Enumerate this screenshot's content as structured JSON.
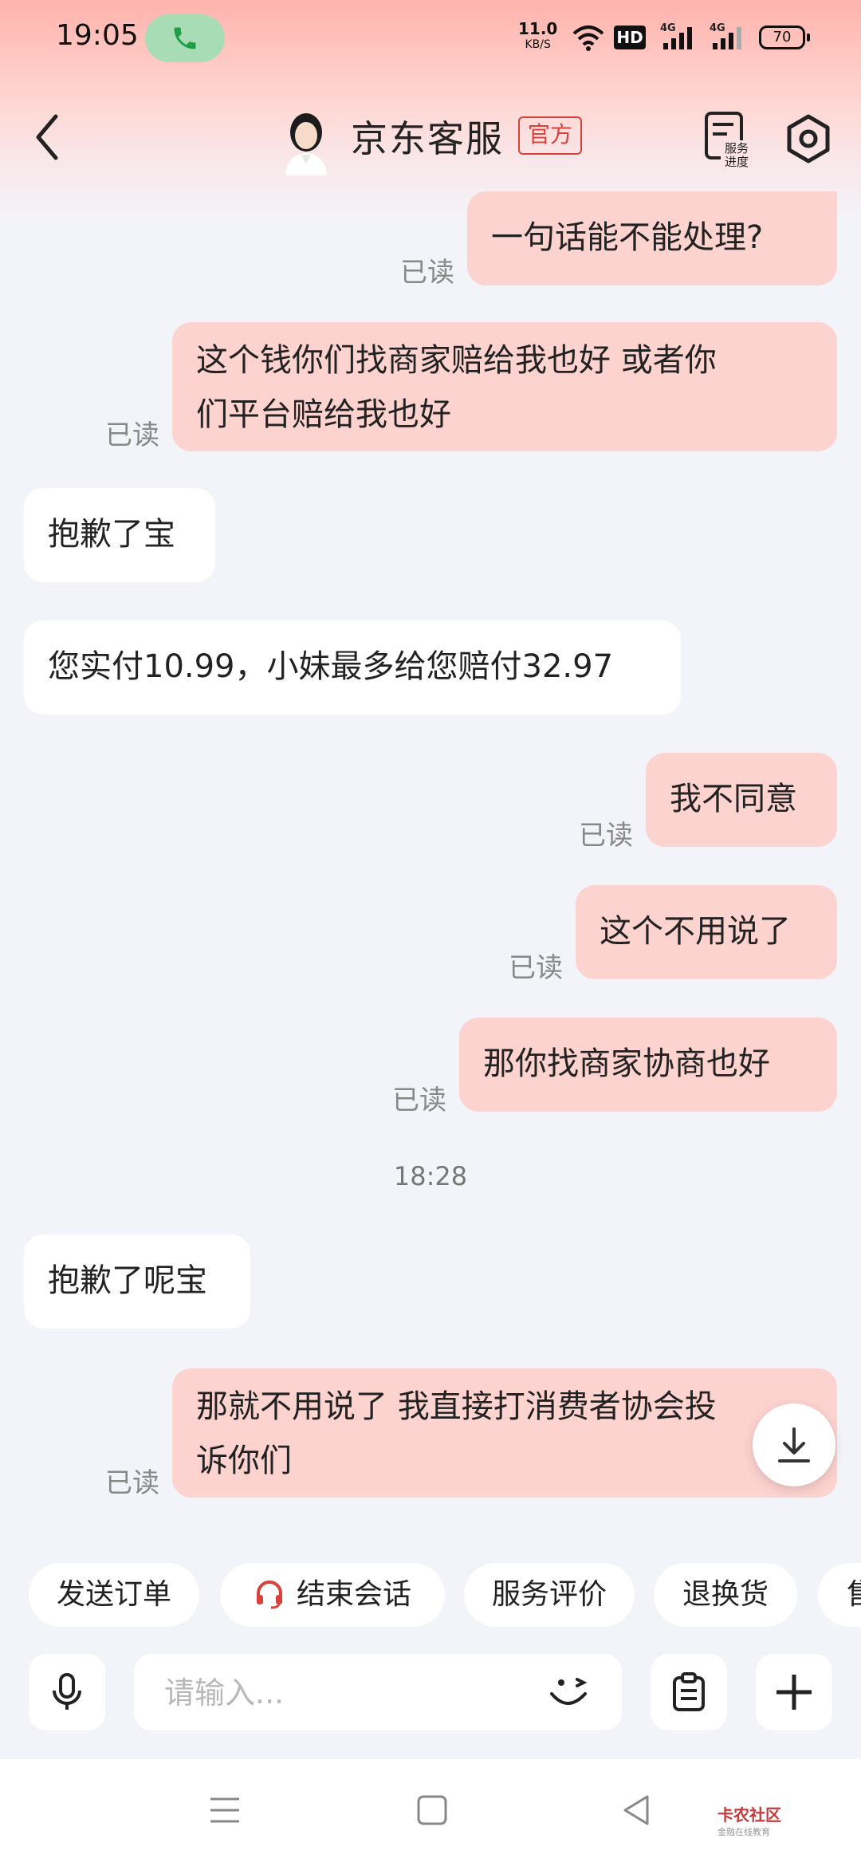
{
  "status": {
    "time": "19:05",
    "net_speed": "11.0",
    "net_unit": "KB/S",
    "hd": "HD",
    "sig1": "4G",
    "sig2": "4G",
    "battery": "70"
  },
  "header": {
    "title": "京东客服",
    "badge": "官方",
    "service_progress": [
      "服务",
      "进度"
    ]
  },
  "messages": {
    "m1": "一句话能不能处理?",
    "m2_l1": "这个钱你们找商家赔给我也好 或者你",
    "m2_l2": "们平台赔给我也好",
    "m3": "抱歉了宝",
    "m4": "您实付10.99，小妹最多给您赔付32.97",
    "m5": "我不同意",
    "m6": "这个不用说了",
    "m7": "那你找商家协商也好",
    "timestamp": "18:28",
    "m8": "抱歉了呢宝",
    "m9_l1": "那就不用说了 我直接打消费者协会投",
    "m9_l2": "诉你们",
    "read_label": "已读"
  },
  "quick_actions": [
    "发送订单",
    "结束会话",
    "服务评价",
    "退换货",
    "售"
  ],
  "input": {
    "placeholder": "请输入..."
  },
  "watermark": {
    "brand": "卡农社区",
    "slogan": "金融在线教育"
  },
  "colors": {
    "my_bubble": "#fdd3d0",
    "accent_red": "#d8423a",
    "bg": "#f3f4f9"
  }
}
